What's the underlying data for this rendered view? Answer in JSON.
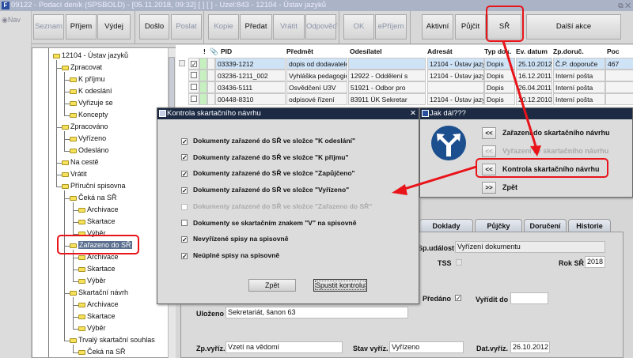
{
  "window": {
    "title": "09122 - Podací deník (SPSBOLD) - [05.11.2018, 09:32]  [ ]  [ ] - Uzel:843 - 12104 - Ústav jazyků",
    "logo": "F",
    "controls": "⧉ ✕"
  },
  "nav": "Nav",
  "toolbar": [
    {
      "label": "Seznam",
      "enabled": false
    },
    {
      "label": "Příjem",
      "enabled": true
    },
    {
      "label": "Výdej",
      "enabled": true
    },
    {
      "label": "Došlo",
      "enabled": true
    },
    {
      "label": "Poslat",
      "enabled": false
    },
    {
      "label": "Kopie",
      "enabled": false
    },
    {
      "label": "Předat",
      "enabled": true
    },
    {
      "label": "Vrátit",
      "enabled": false
    },
    {
      "label": "Odpověď",
      "enabled": false
    },
    {
      "label": "OK",
      "enabled": false
    },
    {
      "label": "ePříjem",
      "enabled": false
    },
    {
      "label": "Aktivní",
      "enabled": true
    },
    {
      "label": "Půjčit",
      "enabled": true
    },
    {
      "label": "SŘ",
      "enabled": true
    },
    {
      "label": "Další akce",
      "enabled": true
    }
  ],
  "tree": [
    {
      "label": "12104 - Ústav jazyků",
      "level": 0
    },
    {
      "label": "Zpracovat",
      "level": 1
    },
    {
      "label": "K příjmu",
      "level": 2
    },
    {
      "label": "K odeslání",
      "level": 2
    },
    {
      "label": "Vyřizuje se",
      "level": 2
    },
    {
      "label": "Koncepty",
      "level": 2
    },
    {
      "label": "Zpracováno",
      "level": 1
    },
    {
      "label": "Vyřízeno",
      "level": 2
    },
    {
      "label": "Odesláno",
      "level": 2
    },
    {
      "label": "Na cestě",
      "level": 1
    },
    {
      "label": "Vrátit",
      "level": 1
    },
    {
      "label": "Příruční spisovna",
      "level": 1
    },
    {
      "label": "Čeká na SŘ",
      "level": 2
    },
    {
      "label": "Archivace",
      "level": 3
    },
    {
      "label": "Skartace",
      "level": 3
    },
    {
      "label": "Výběr",
      "level": 3
    },
    {
      "label": "Zařazeno do SŘ",
      "level": 2,
      "selected": true
    },
    {
      "label": "Archivace",
      "level": 3
    },
    {
      "label": "Skartace",
      "level": 3
    },
    {
      "label": "Výběr",
      "level": 3
    },
    {
      "label": "Skartační návrh",
      "level": 2
    },
    {
      "label": "Archivace",
      "level": 3
    },
    {
      "label": "Skartace",
      "level": 3
    },
    {
      "label": "Výběr",
      "level": 3
    },
    {
      "label": "Trvalý skartační souhlas",
      "level": 2
    },
    {
      "label": "Čeká na SŘ",
      "level": 3
    }
  ],
  "grid": {
    "headers": [
      "!",
      "📎",
      "PID",
      "Předmět",
      "Odesílatel",
      "Adresát",
      "Typ dok.",
      "Ev. datum",
      "Zp.doruč.",
      "Poc"
    ],
    "rows": [
      {
        "checked": true,
        "pid": "03339-1212",
        "predmet": "dopis od dodavatele",
        "odesilatel": "",
        "adresat": "12104 - Ústav jazy",
        "typ": "Dopis",
        "datum": "25.10.2012",
        "zp": "Č.P. doporuče",
        "poc": "467"
      },
      {
        "checked": false,
        "pid": "03236-1211_002",
        "predmet": "Vyhláška pedagogické",
        "odesilatel": "12922 - Oddělení s",
        "adresat": "12104 - Ústav jazy",
        "typ": "Dopis",
        "datum": "16.12.2011",
        "zp": "Interní pošta",
        "poc": ""
      },
      {
        "checked": false,
        "pid": "03436-5111",
        "predmet": "Osvědčení U3V",
        "odesilatel": "51921 - Odbor pro",
        "adresat": "",
        "typ": "Dopis",
        "datum": "26.04.2011",
        "zp": "Interní pošta",
        "poc": ""
      },
      {
        "checked": false,
        "pid": "00448-8310",
        "predmet": "odpisové řízení",
        "odesilatel": "83911 ÚK Sekretar",
        "adresat": "12104 - Ústav jazy",
        "typ": "Dopis",
        "datum": "20.12.2010",
        "zp": "Interní pošta",
        "poc": ""
      }
    ]
  },
  "kontrola": {
    "title": "Kontrola skartačního návrhu",
    "close": "✕",
    "items": [
      {
        "label": "Dokumenty zařazené do SŘ ve složce \"K odeslání\"",
        "checked": true,
        "enabled": true
      },
      {
        "label": "Dokumenty zařazené do SŘ ve složce \"K příjmu\"",
        "checked": true,
        "enabled": true
      },
      {
        "label": "Dokumenty zařazené do SŘ ve složce \"Zapůjčeno\"",
        "checked": true,
        "enabled": true
      },
      {
        "label": "Dokumenty zařazené do SŘ ve složce \"Vyřízeno\"",
        "checked": true,
        "enabled": true
      },
      {
        "label": "Dokumenty zařazené do SŘ ve složce \"Zařazeno do SŘ\"",
        "checked": false,
        "enabled": false
      },
      {
        "label": "Dokumenty se skartačním znakem \"V\" na spisovně",
        "checked": false,
        "enabled": true
      },
      {
        "label": "Nevyřízené spisy na spisovně",
        "checked": true,
        "enabled": true
      },
      {
        "label": "Neúplné spisy na spisovně",
        "checked": true,
        "enabled": true
      }
    ],
    "back": "Zpět",
    "run": "Spustit kontrolu"
  },
  "jak": {
    "title": "Jak dál???",
    "items": [
      {
        "btn": "<<",
        "label": "Zařazení do skartačního návrhu",
        "enabled": true
      },
      {
        "btn": "<<",
        "label": "Vyřazení ze skartačního návrhu",
        "enabled": false
      },
      {
        "btn": "<<",
        "label": "Kontrola skartačního návrhu",
        "enabled": true
      },
      {
        "btn": ">>",
        "label": "Zpět",
        "enabled": true
      }
    ]
  },
  "tabs": [
    "Doklady",
    "Půjčky",
    "Doručení",
    "Historie"
  ],
  "form": {
    "sp_udalost_label": "Sp.událost",
    "sp_udalost": "Vyřízení dokumentu",
    "tss_label": "TSS",
    "rok_label": "Rok SŘ",
    "rok": "2018",
    "predano_label": "Předáno",
    "predano": true,
    "vyridit_label": "Vyřídit do",
    "vyridit": "",
    "ulozeno_label": "Uloženo",
    "ulozeno": "Sekretariát, šanon 63",
    "zp_label": "Zp.vyříz.",
    "zp": "Vzetí na vědomí",
    "stav_label": "Stav vyříz.",
    "stav": "Vyřízeno",
    "dat_label": "Dat.vyříz.",
    "dat": "26.10.2012"
  },
  "colors": {
    "highlight": "#e8141a",
    "dialog_title": "#1c2a44",
    "selection": "#5b6f8f",
    "row_selected": "#cfe3f7",
    "status_green": "#c6f0c0"
  }
}
